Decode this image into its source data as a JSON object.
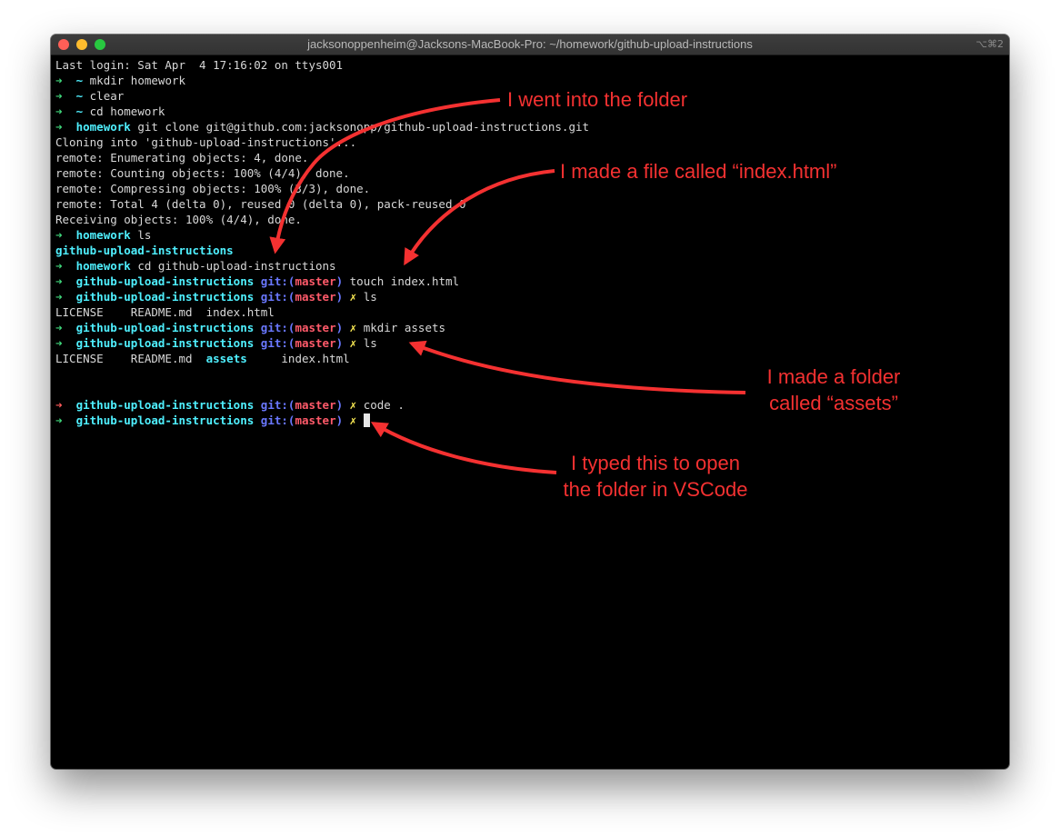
{
  "window": {
    "title": "jacksonoppenheim@Jacksons-MacBook-Pro: ~/homework/github-upload-instructions",
    "shortcut": "⌥⌘2"
  },
  "colors": {
    "background": "#000000",
    "prompt_arrow": "#3fd67b",
    "prompt_arrow_error": "#ff5a5a",
    "directory": "#4ff0ff",
    "git_label": "#6a78ff",
    "branch": "#ff5a6a",
    "dirty_marker": "#ffee55",
    "annotation": "#f43131"
  },
  "terminal": {
    "login": "Last login: Sat Apr  4 17:16:02 on ttys001",
    "arrow": "➜",
    "tilde": "~",
    "cmd_mkdir_homework": "mkdir homework",
    "cmd_clear": "clear",
    "cmd_cd_homework": "cd homework",
    "homework_dir": "homework",
    "cmd_clone": "git clone git@github.com:jacksonopp/github-upload-instructions.git",
    "clone_out": [
      "Cloning into 'github-upload-instructions'...",
      "remote: Enumerating objects: 4, done.",
      "remote: Counting objects: 100% (4/4), done.",
      "remote: Compressing objects: 100% (3/3), done.",
      "remote: Total 4 (delta 0), reused 0 (delta 0), pack-reused 0",
      "Receiving objects: 100% (4/4), done."
    ],
    "cmd_ls": "ls",
    "repo_dir": "github-upload-instructions",
    "cmd_cd_repo": "cd github-upload-instructions",
    "git_prefix": "git:(",
    "branch": "master",
    "git_suffix": ")",
    "dirty": "✗",
    "cmd_touch": "touch index.html",
    "ls_out_1": "LICENSE    README.md  index.html",
    "cmd_mkdir_assets": "mkdir assets",
    "ls_out_2_files": [
      "LICENSE",
      "README.md"
    ],
    "ls_out_2_dir": "assets",
    "ls_out_2_last": "index.html",
    "cmd_code": "code ."
  },
  "annotations": {
    "folder": "I went into the folder",
    "file": "I made a file called “index.html”",
    "assets_line1": "I made a folder",
    "assets_line2": "called “assets”",
    "vscode_line1": "I typed this to open",
    "vscode_line2": "the folder in VSCode"
  }
}
